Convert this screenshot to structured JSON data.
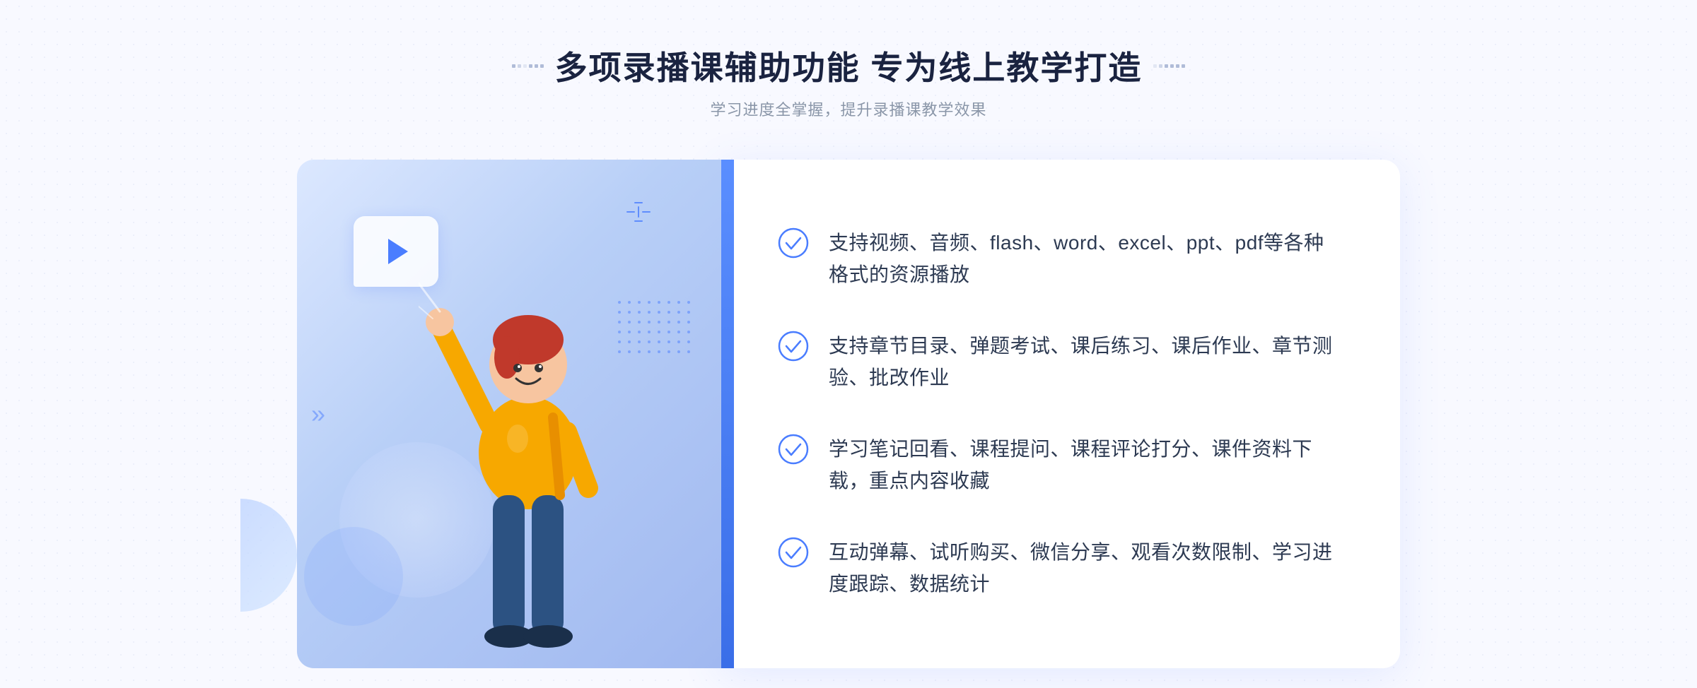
{
  "header": {
    "main_title": "多项录播课辅助功能 专为线上教学打造",
    "subtitle": "学习进度全掌握，提升录播课教学效果"
  },
  "features": [
    {
      "id": 1,
      "text": "支持视频、音频、flash、word、excel、ppt、pdf等各种格式的资源播放"
    },
    {
      "id": 2,
      "text": "支持章节目录、弹题考试、课后练习、课后作业、章节测验、批改作业"
    },
    {
      "id": 3,
      "text": "学习笔记回看、课程提问、课程评论打分、课件资料下载，重点内容收藏"
    },
    {
      "id": 4,
      "text": "互动弹幕、试听购买、微信分享、观看次数限制、学习进度跟踪、数据统计"
    }
  ],
  "illustration": {
    "play_icon": "▶",
    "chevron": "»"
  },
  "colors": {
    "primary": "#4a7dff",
    "title": "#1a2340",
    "text": "#2d3a52",
    "subtitle": "#8a96a8",
    "bg": "#f8f9ff",
    "panel_bg": "#ffffff",
    "illus_bg_start": "#dce8ff",
    "illus_bg_end": "#a0b8f0"
  }
}
